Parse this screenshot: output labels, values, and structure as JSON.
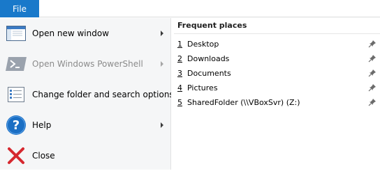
{
  "ribbon": {
    "file_tab_label": "File"
  },
  "menu": {
    "items": [
      {
        "label": "Open new window",
        "icon": "new-window-icon",
        "submenu": true,
        "enabled": true
      },
      {
        "label": "Open Windows PowerShell",
        "icon": "powershell-icon",
        "submenu": true,
        "enabled": false
      },
      {
        "label": "Change folder and search options",
        "icon": "folder-options-icon",
        "submenu": false,
        "enabled": true
      },
      {
        "label": "Help",
        "icon": "help-icon",
        "submenu": true,
        "enabled": true
      },
      {
        "label": "Close",
        "icon": "close-icon",
        "submenu": false,
        "enabled": true
      }
    ]
  },
  "frequent_places": {
    "header": "Frequent places",
    "items": [
      {
        "number": "1",
        "name": "Desktop"
      },
      {
        "number": "2",
        "name": "Downloads"
      },
      {
        "number": "3",
        "name": "Documents"
      },
      {
        "number": "4",
        "name": "Pictures"
      },
      {
        "number": "5",
        "name": "SharedFolder (\\\\VBoxSvr) (Z:)"
      }
    ]
  },
  "colors": {
    "file_tab": "#1979ca",
    "menu_background": "#f5f6f7",
    "help_blue": "#1b6fc4",
    "close_red": "#d6282f"
  }
}
